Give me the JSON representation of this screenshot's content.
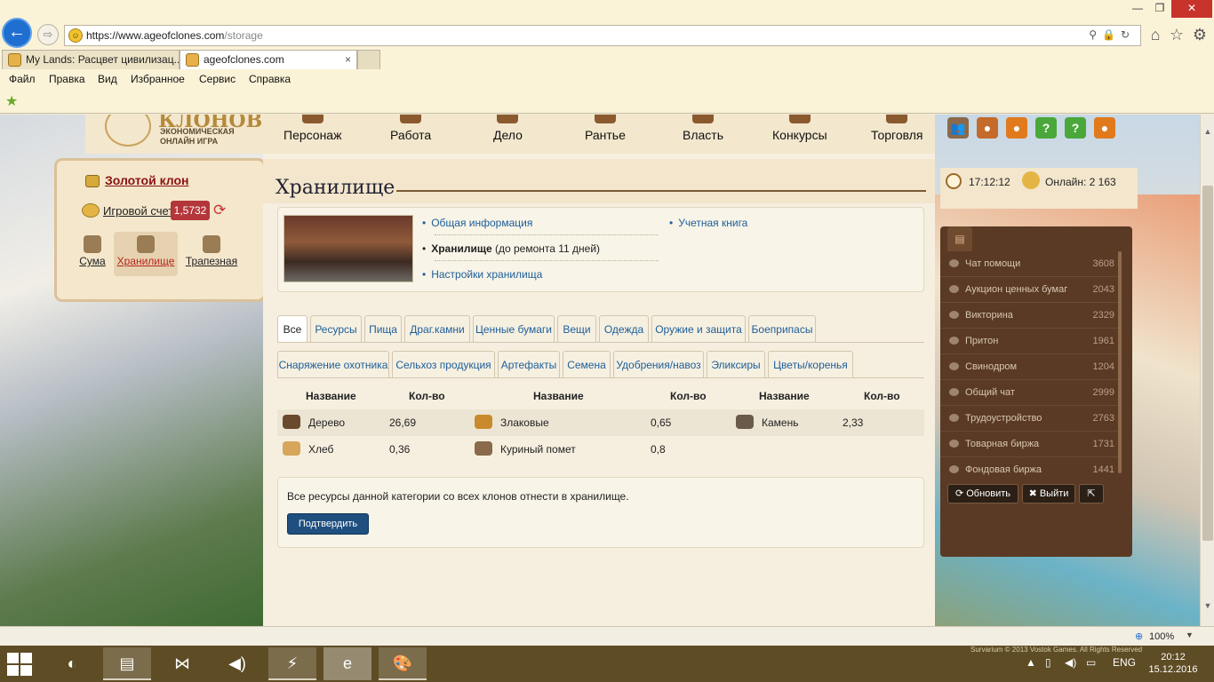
{
  "browser": {
    "url_base": "https://www.ageofclones.com",
    "url_path": "/storage",
    "tabs": [
      {
        "title": "My Lands: Расцвет цивилизац...",
        "active": false
      },
      {
        "title": "ageofclones.com",
        "active": true,
        "close": "×"
      }
    ],
    "menu": [
      "Файл",
      "Правка",
      "Вид",
      "Избранное",
      "Сервис",
      "Справка"
    ],
    "window_buttons": {
      "minimize": "—",
      "maximize": "❐",
      "close": "✕"
    }
  },
  "header": {
    "logo_title": "КЛОНОВ",
    "logo_subtitle": "ЭКОНОМИЧЕСКАЯ ОНЛАЙН ИГРА",
    "nav": [
      "Персонаж",
      "Работа",
      "Дело",
      "Рантье",
      "Власть",
      "Конкурсы",
      "Торговля"
    ]
  },
  "left_panel": {
    "gold_clone": "Золотой клон",
    "account_label": "Игровой счет",
    "account_value": "1,5732",
    "items": [
      {
        "label": "Сума",
        "active": false
      },
      {
        "label": "Хранилище",
        "active": true
      },
      {
        "label": "Трапезная",
        "active": false
      }
    ]
  },
  "main": {
    "title": "Хранилище",
    "info_links": {
      "general": "Общая информация",
      "storage_current_bold": "Хранилище",
      "storage_current_rest": " (до ремонта 11 дней)",
      "settings": "Настройки хранилища",
      "ledger": "Учетная книга"
    },
    "category_tabs_row1": [
      "Все",
      "Ресурсы",
      "Пища",
      "Драг.камни",
      "Ценные бумаги",
      "Вещи",
      "Одежда",
      "Оружие и защита",
      "Боеприпасы"
    ],
    "category_tabs_row2": [
      "Снаряжение охотника",
      "Сельхоз продукция",
      "Артефакты",
      "Семена",
      "Удобрения/навоз",
      "Эликсиры",
      "Цветы/коренья"
    ],
    "table": {
      "headers": [
        "Название",
        "Кол-во",
        "Название",
        "Кол-во",
        "Название",
        "Кол-во"
      ],
      "rows": [
        [
          {
            "name": "Дерево",
            "qty": "26,69"
          },
          {
            "name": "Злаковые",
            "qty": "0,65"
          },
          {
            "name": "Камень",
            "qty": "2,33"
          }
        ],
        [
          {
            "name": "Хлеб",
            "qty": "0,36"
          },
          {
            "name": "Куриный помет",
            "qty": "0,8"
          }
        ]
      ]
    },
    "confirm": {
      "text": "Все ресурсы данной категории со всех клонов отнести в хранилище.",
      "button": "Подтвердить"
    }
  },
  "right_panel": {
    "time": "17:12:12",
    "online": "Онлайн: 2 163",
    "chats": [
      {
        "name": "Чат помощи",
        "count": "3608"
      },
      {
        "name": "Аукцион ценных бумаг",
        "count": "2043"
      },
      {
        "name": "Викторина",
        "count": "2329"
      },
      {
        "name": "Притон",
        "count": "1961"
      },
      {
        "name": "Свинодром",
        "count": "1204"
      },
      {
        "name": "Общий чат",
        "count": "2999"
      },
      {
        "name": "Трудоустройство",
        "count": "2763"
      },
      {
        "name": "Товарная биржа",
        "count": "1731"
      },
      {
        "name": "Фондовая биржа",
        "count": "1441"
      }
    ],
    "refresh": "Обновить",
    "logout": "Выйти"
  },
  "statusbar": {
    "zoom": "100%"
  },
  "taskbar": {
    "lang": "ENG",
    "time": "20:12",
    "date": "15.12.2016",
    "watermark": "Survarium © 2013 Vostok Games. All Rights Reserved"
  },
  "colors": {
    "accent_red": "#b4363a",
    "link_blue": "#1d5e98",
    "button_blue": "#1f4f7e",
    "chat_bg": "#5a3a24"
  }
}
